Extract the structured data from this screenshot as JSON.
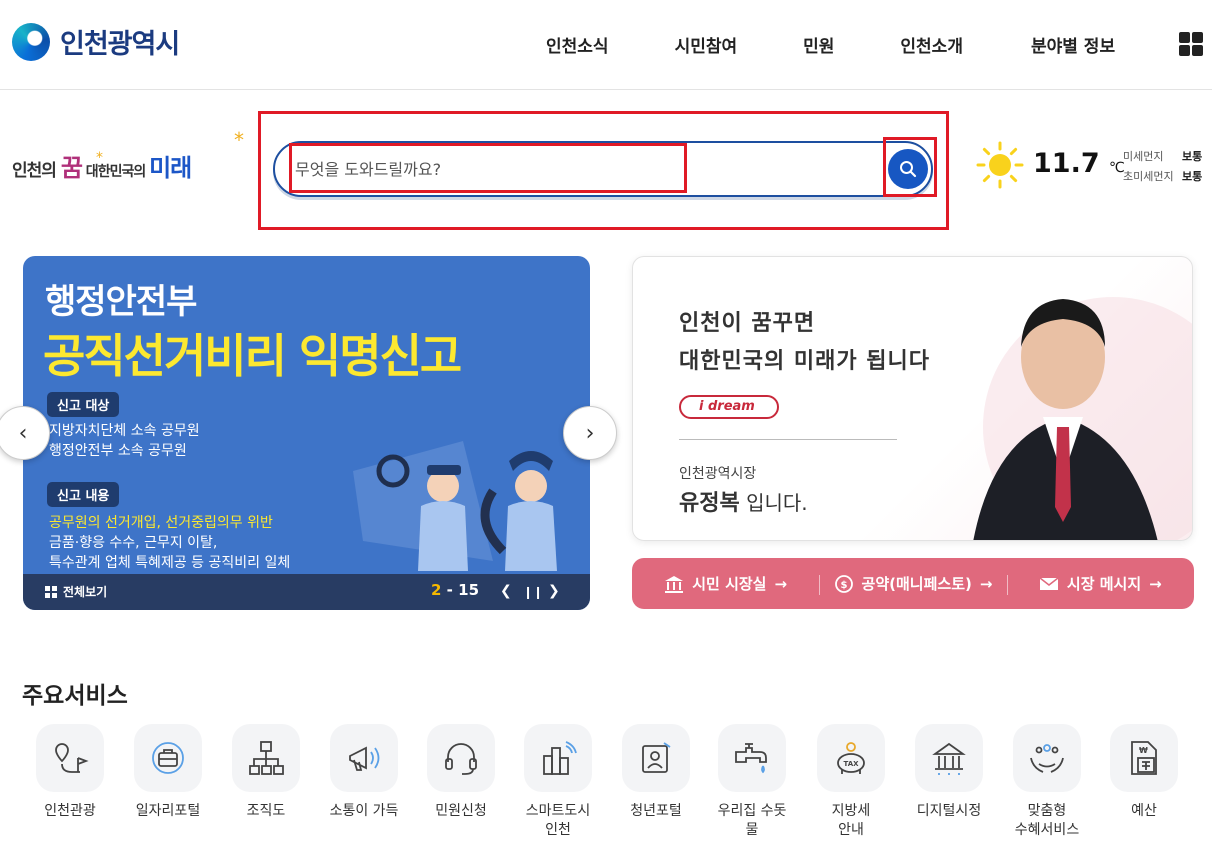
{
  "header": {
    "logo_text": "인천광역시",
    "nav": [
      "인천소식",
      "시민참여",
      "민원",
      "인천소개",
      "분야별 정보"
    ]
  },
  "slogan": {
    "part1": "인천의 ",
    "dream": "꿈",
    "part2": " 대한민국의 ",
    "future": "미래"
  },
  "search": {
    "placeholder": "무엇을 도와드릴까요?"
  },
  "weather": {
    "temp": "11.7",
    "unit": "℃",
    "fine_dust_label": "미세먼지",
    "fine_dust_value": "보통",
    "ultrafine_dust_label": "초미세먼지",
    "ultrafine_dust_value": "보통",
    "icon": "sun-icon"
  },
  "banner": {
    "subtitle": "행정안전부",
    "title": "공직선거비리 익명신고",
    "tag1": "신고 대상",
    "target_lines": [
      "지방자치단체 소속 공무원",
      "행정안전부 소속 공무원"
    ],
    "tag2": "신고 내용",
    "content_lines": [
      "공무원의 선거개입, 선거중립의무 위반",
      "금품·향응 수수, 근무지 이탈,",
      "특수관계 업체 특혜제공 등 공직비리 일체"
    ],
    "view_all": "전체보기",
    "page_current": "2",
    "page_sep": "-",
    "page_total": "15",
    "bg_color": "#3e74c8"
  },
  "mayor": {
    "line1": "인천이 꿈꾸면",
    "line2": "대한민국의 미래가 됩니다",
    "badge": "i dream",
    "role": "인천광역시장",
    "name": "유정복",
    "name_suffix": " 입니다."
  },
  "mayor_links": [
    {
      "label": "시민 시장실",
      "icon": "building-icon"
    },
    {
      "label": "공약(매니페스토)",
      "icon": "coin-icon"
    },
    {
      "label": "시장 메시지",
      "icon": "mail-icon"
    }
  ],
  "services": {
    "title": "주요서비스",
    "items": [
      {
        "label": "인천관광",
        "icon": "map-pin-icon"
      },
      {
        "label": "일자리포털",
        "icon": "briefcase-icon"
      },
      {
        "label": "조직도",
        "icon": "org-chart-icon"
      },
      {
        "label": "소통이 가득",
        "icon": "megaphone-icon"
      },
      {
        "label": "민원신청",
        "icon": "headset-icon"
      },
      {
        "label": "스마트도시\n인천",
        "icon": "smart-city-icon"
      },
      {
        "label": "청년포털",
        "icon": "id-card-icon"
      },
      {
        "label": "우리집 수돗물",
        "icon": "faucet-icon"
      },
      {
        "label": "지방세\n안내",
        "icon": "piggy-bank-icon"
      },
      {
        "label": "디지털시정",
        "icon": "digital-hall-icon"
      },
      {
        "label": "맞춤형\n수혜서비스",
        "icon": "hands-people-icon"
      },
      {
        "label": "예산",
        "icon": "calculator-icon"
      }
    ]
  },
  "colors": {
    "accent": "#1757c2",
    "pink": "#e0697d",
    "highlight": "#e01a26"
  }
}
